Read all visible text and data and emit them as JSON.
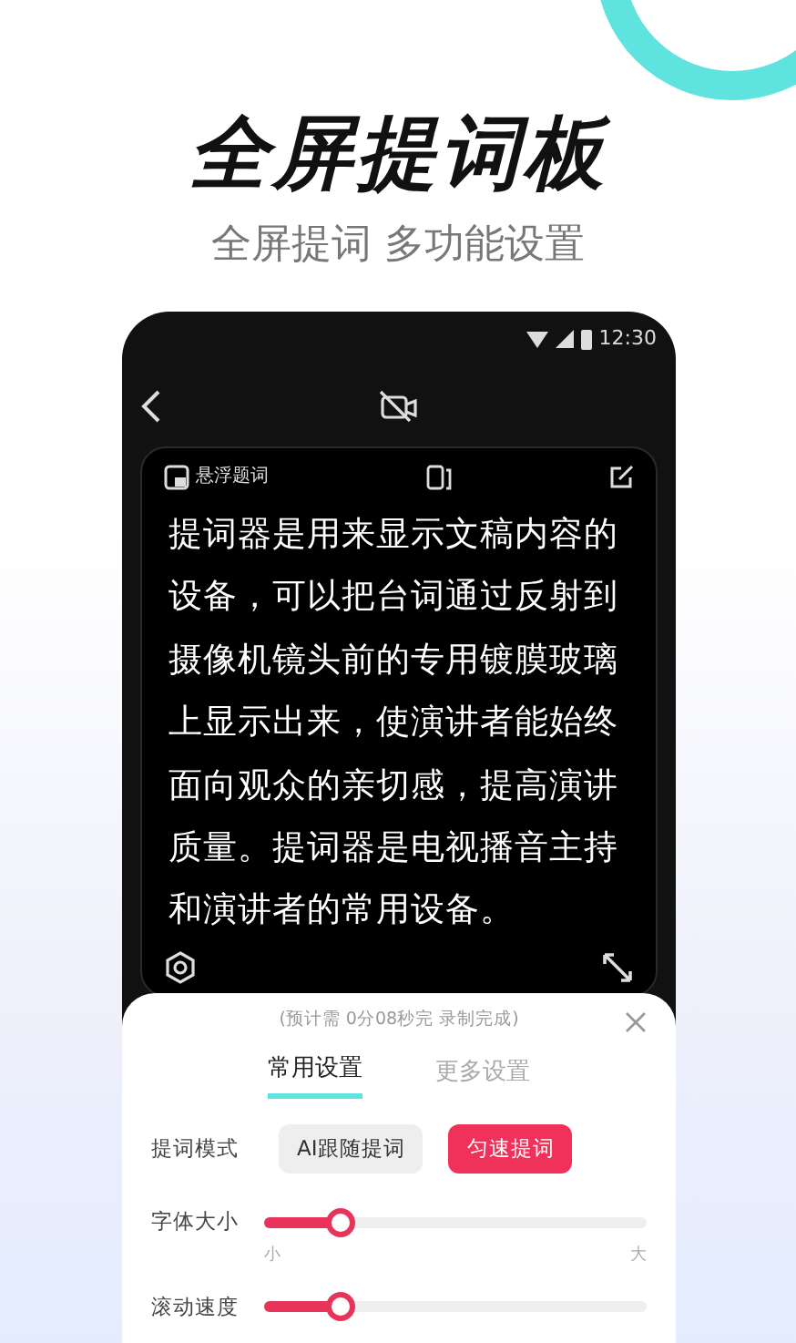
{
  "headline": "全屏提词板",
  "subtitle": "全屏提词 多功能设置",
  "status_bar": {
    "time": "12:30"
  },
  "prompter": {
    "float_label": "悬浮题词",
    "text": "提词器是用来显示文稿内容的设备，可以把台词通过反射到摄像机镜头前的专用镀膜玻璃上显示出来，使演讲者能始终面向观众的亲切感，提高演讲质量。提词器是电视播音主持和演讲者的常用设备。"
  },
  "sheet": {
    "estimate": "(预计需 0分08秒完 录制完成)",
    "tabs": [
      {
        "label": "常用设置",
        "selected": true
      },
      {
        "label": "更多设置",
        "selected": false
      }
    ],
    "mode": {
      "label": "提词模式",
      "options": [
        {
          "label": "AI跟随提词",
          "selected": false
        },
        {
          "label": "匀速提词",
          "selected": true
        }
      ]
    },
    "sliders": [
      {
        "label": "字体大小",
        "level": 0.2,
        "min_label": "小",
        "max_label": "大"
      },
      {
        "label": "滚动速度",
        "level": 0.2
      }
    ]
  }
}
